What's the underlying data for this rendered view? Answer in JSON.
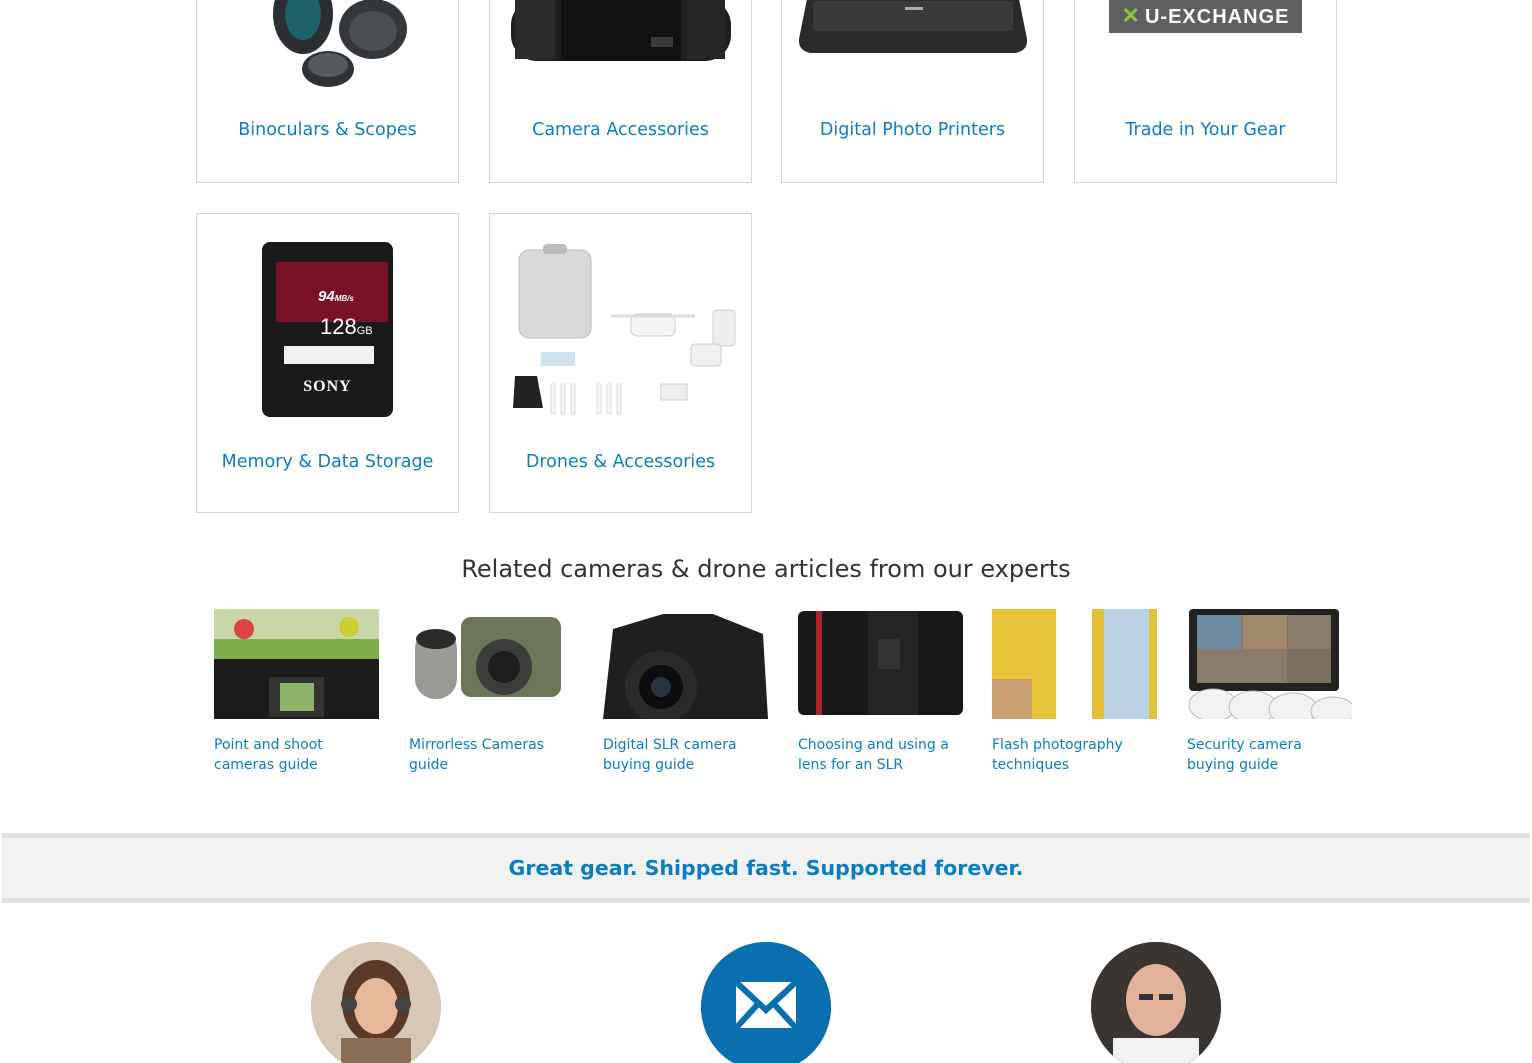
{
  "categories": [
    {
      "label": "Binoculars & Scopes",
      "image": "binoculars-image"
    },
    {
      "label": "Camera Accessories",
      "image": "lens-image"
    },
    {
      "label": "Digital Photo Printers",
      "image": "printer-image"
    },
    {
      "label": "Trade in Your Gear",
      "image": "exchange-logo-image",
      "logo_text": "U-EXCHANGE"
    },
    {
      "label": "Memory & Data Storage",
      "image": "sd-card-image",
      "card": {
        "brand": "SONY",
        "capacity": "128",
        "unit": "GB",
        "speed": "94",
        "speed_unit": "MB/s"
      }
    },
    {
      "label": "Drones & Accessories",
      "image": "drone-kit-image"
    }
  ],
  "articles": {
    "title": "Related cameras & drone articles from our experts",
    "items": [
      {
        "caption": "Point and shoot cameras guide"
      },
      {
        "caption": "Mirrorless Cameras guide"
      },
      {
        "caption": "Digital SLR camera buying guide"
      },
      {
        "caption": "Choosing and using a lens for an SLR"
      },
      {
        "caption": "Flash photography techniques"
      },
      {
        "caption": "Security camera buying guide"
      }
    ]
  },
  "band": {
    "tagline": "Great gear. Shipped fast. Supported forever."
  },
  "colors": {
    "link": "#0a7ec2",
    "band_bg": "#f2f2f2",
    "circle_blue": "#0a6fae"
  }
}
